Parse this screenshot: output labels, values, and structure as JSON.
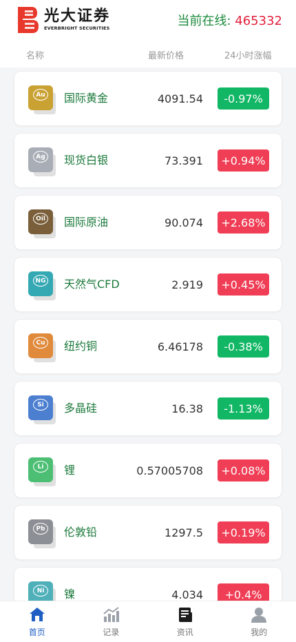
{
  "header": {
    "brand_cn": "光大证券",
    "brand_en": "EVERBRIGHT SECURITIES",
    "online_label": "当前在线:",
    "online_count": "465332"
  },
  "columns": {
    "name": "名称",
    "price": "最新价格",
    "change": "24小时涨幅"
  },
  "items": [
    {
      "symbol": "Au",
      "icon": "gold-icon",
      "color": "#c9a233",
      "name": "国际黄金",
      "price": "4091.54",
      "change": "-0.97%",
      "dir": "down"
    },
    {
      "symbol": "Ag",
      "icon": "silver-icon",
      "color": "#a9adb6",
      "name": "现货白银",
      "price": "73.391",
      "change": "+0.94%",
      "dir": "up"
    },
    {
      "symbol": "Oil",
      "icon": "crude-oil-icon",
      "color": "#7a5f3a",
      "name": "国际原油",
      "price": "90.074",
      "change": "+2.68%",
      "dir": "up"
    },
    {
      "symbol": "NG",
      "icon": "natural-gas-icon",
      "color": "#35a9b3",
      "name": "天然气CFD",
      "price": "2.919",
      "change": "+0.45%",
      "dir": "up"
    },
    {
      "symbol": "Cu",
      "icon": "copper-icon",
      "color": "#e08a3c",
      "name": "纽约铜",
      "price": "6.46178",
      "change": "-0.38%",
      "dir": "down"
    },
    {
      "symbol": "Si",
      "icon": "silicon-icon",
      "color": "#4d7fd0",
      "name": "多晶硅",
      "price": "16.38",
      "change": "-1.13%",
      "dir": "down"
    },
    {
      "symbol": "Li",
      "icon": "lithium-icon",
      "color": "#4cbf74",
      "name": "锂",
      "price": "0.57005708",
      "change": "+0.08%",
      "dir": "up"
    },
    {
      "symbol": "Pb",
      "icon": "lead-icon",
      "color": "#8c8f96",
      "name": "伦敦铅",
      "price": "1297.5",
      "change": "+0.19%",
      "dir": "up"
    },
    {
      "symbol": "Ni",
      "icon": "nickel-icon",
      "color": "#4fb0ba",
      "name": "镍",
      "price": "4.034",
      "change": "+0.4%",
      "dir": "up"
    }
  ],
  "tabs": [
    {
      "label": "首页",
      "icon": "home-icon",
      "active": true
    },
    {
      "label": "记录",
      "icon": "chart-icon",
      "active": false
    },
    {
      "label": "资讯",
      "icon": "news-icon",
      "active": false
    },
    {
      "label": "我的",
      "icon": "user-icon",
      "active": false
    }
  ],
  "colors": {
    "up": "#ef3e55",
    "down": "#12b765",
    "name_green": "#1c7a3c",
    "active_tab": "#1f5fc4"
  }
}
